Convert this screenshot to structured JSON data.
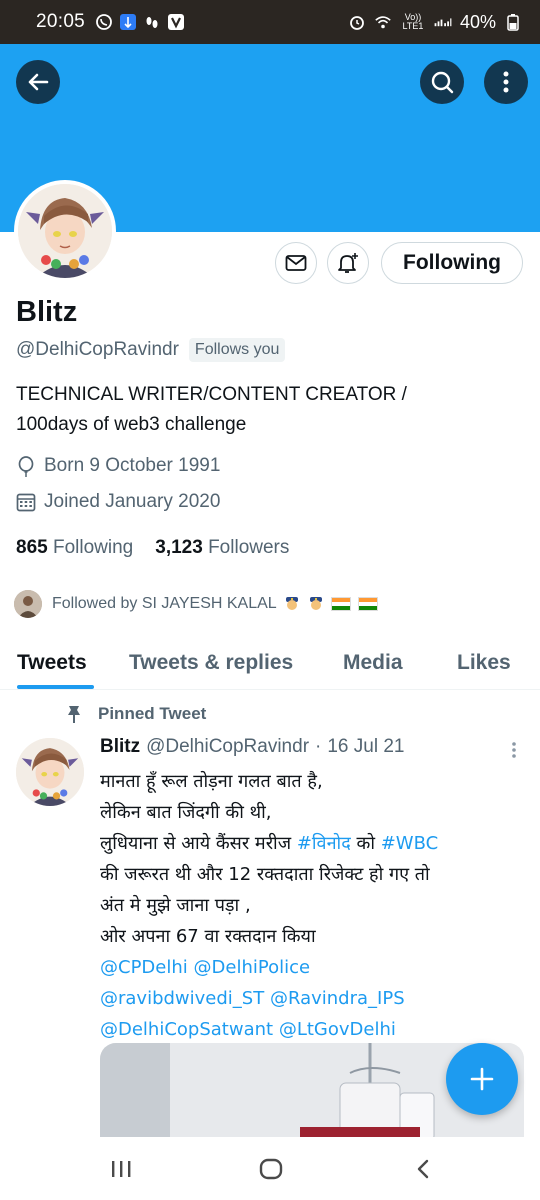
{
  "status_bar": {
    "time": "20:05",
    "battery": "40%",
    "icons": [
      "whatsapp-icon",
      "app-icon",
      "steps-icon",
      "v-icon",
      "alarm-icon",
      "wifi-icon",
      "volte-icon",
      "signal-icon",
      "battery-icon"
    ],
    "volte_label": "Vo)) LTE1"
  },
  "header": {
    "banner_color": "#1da1f2"
  },
  "actions": {
    "following_label": "Following"
  },
  "profile": {
    "name": "Blitz",
    "handle": "@DelhiCopRavindr",
    "follows_you": "Follows you",
    "bio_line1": "TECHNICAL WRITER/CONTENT CREATOR /",
    "bio_line2": "100days of web3 challenge",
    "born": "Born 9 October 1991",
    "joined": "Joined January 2020",
    "following_count": "865",
    "following_label": "Following",
    "followers_count": "3,123",
    "followers_label": "Followers",
    "followed_by": "Followed by SI JAYESH KALAL"
  },
  "tabs": [
    {
      "label": "Tweets",
      "active": true
    },
    {
      "label": "Tweets & replies",
      "active": false
    },
    {
      "label": "Media",
      "active": false
    },
    {
      "label": "Likes",
      "active": false
    }
  ],
  "tweet": {
    "pinned_label": "Pinned Tweet",
    "author": "Blitz",
    "handle": "@DelhiCopRavindr",
    "dot": "·",
    "date": "16 Jul 21",
    "line1": "मानता हूँ रूल तोड़ना गलत बात है,",
    "line2": "लेकिन बात जिंदगी की थी,",
    "line3_pre": "लुधियाना से आये कैंसर मरीज ",
    "line3_tag1": "#विनोद",
    "line3_mid": " को ",
    "line3_tag2": "#WBC",
    "line4": "की जरूरत थी और 12 रक्तदाता रिजेक्ट हो गए तो",
    "line5": "अंत मे मुझे जाना पड़ा ,",
    "line6": "ओर अपना 67 वा रक्तदान किया",
    "mention1": "@CPDelhi",
    "mention2": "@DelhiPolice",
    "mention3": "@ravibdwivedi_ST",
    "mention4": "@Ravindra_IPS",
    "mention5": "@DelhiCopSatwant",
    "mention6": "@LtGovDelhi"
  },
  "colors": {
    "accent": "#1d9bf0",
    "text": "#0f1419",
    "muted": "#536471"
  }
}
